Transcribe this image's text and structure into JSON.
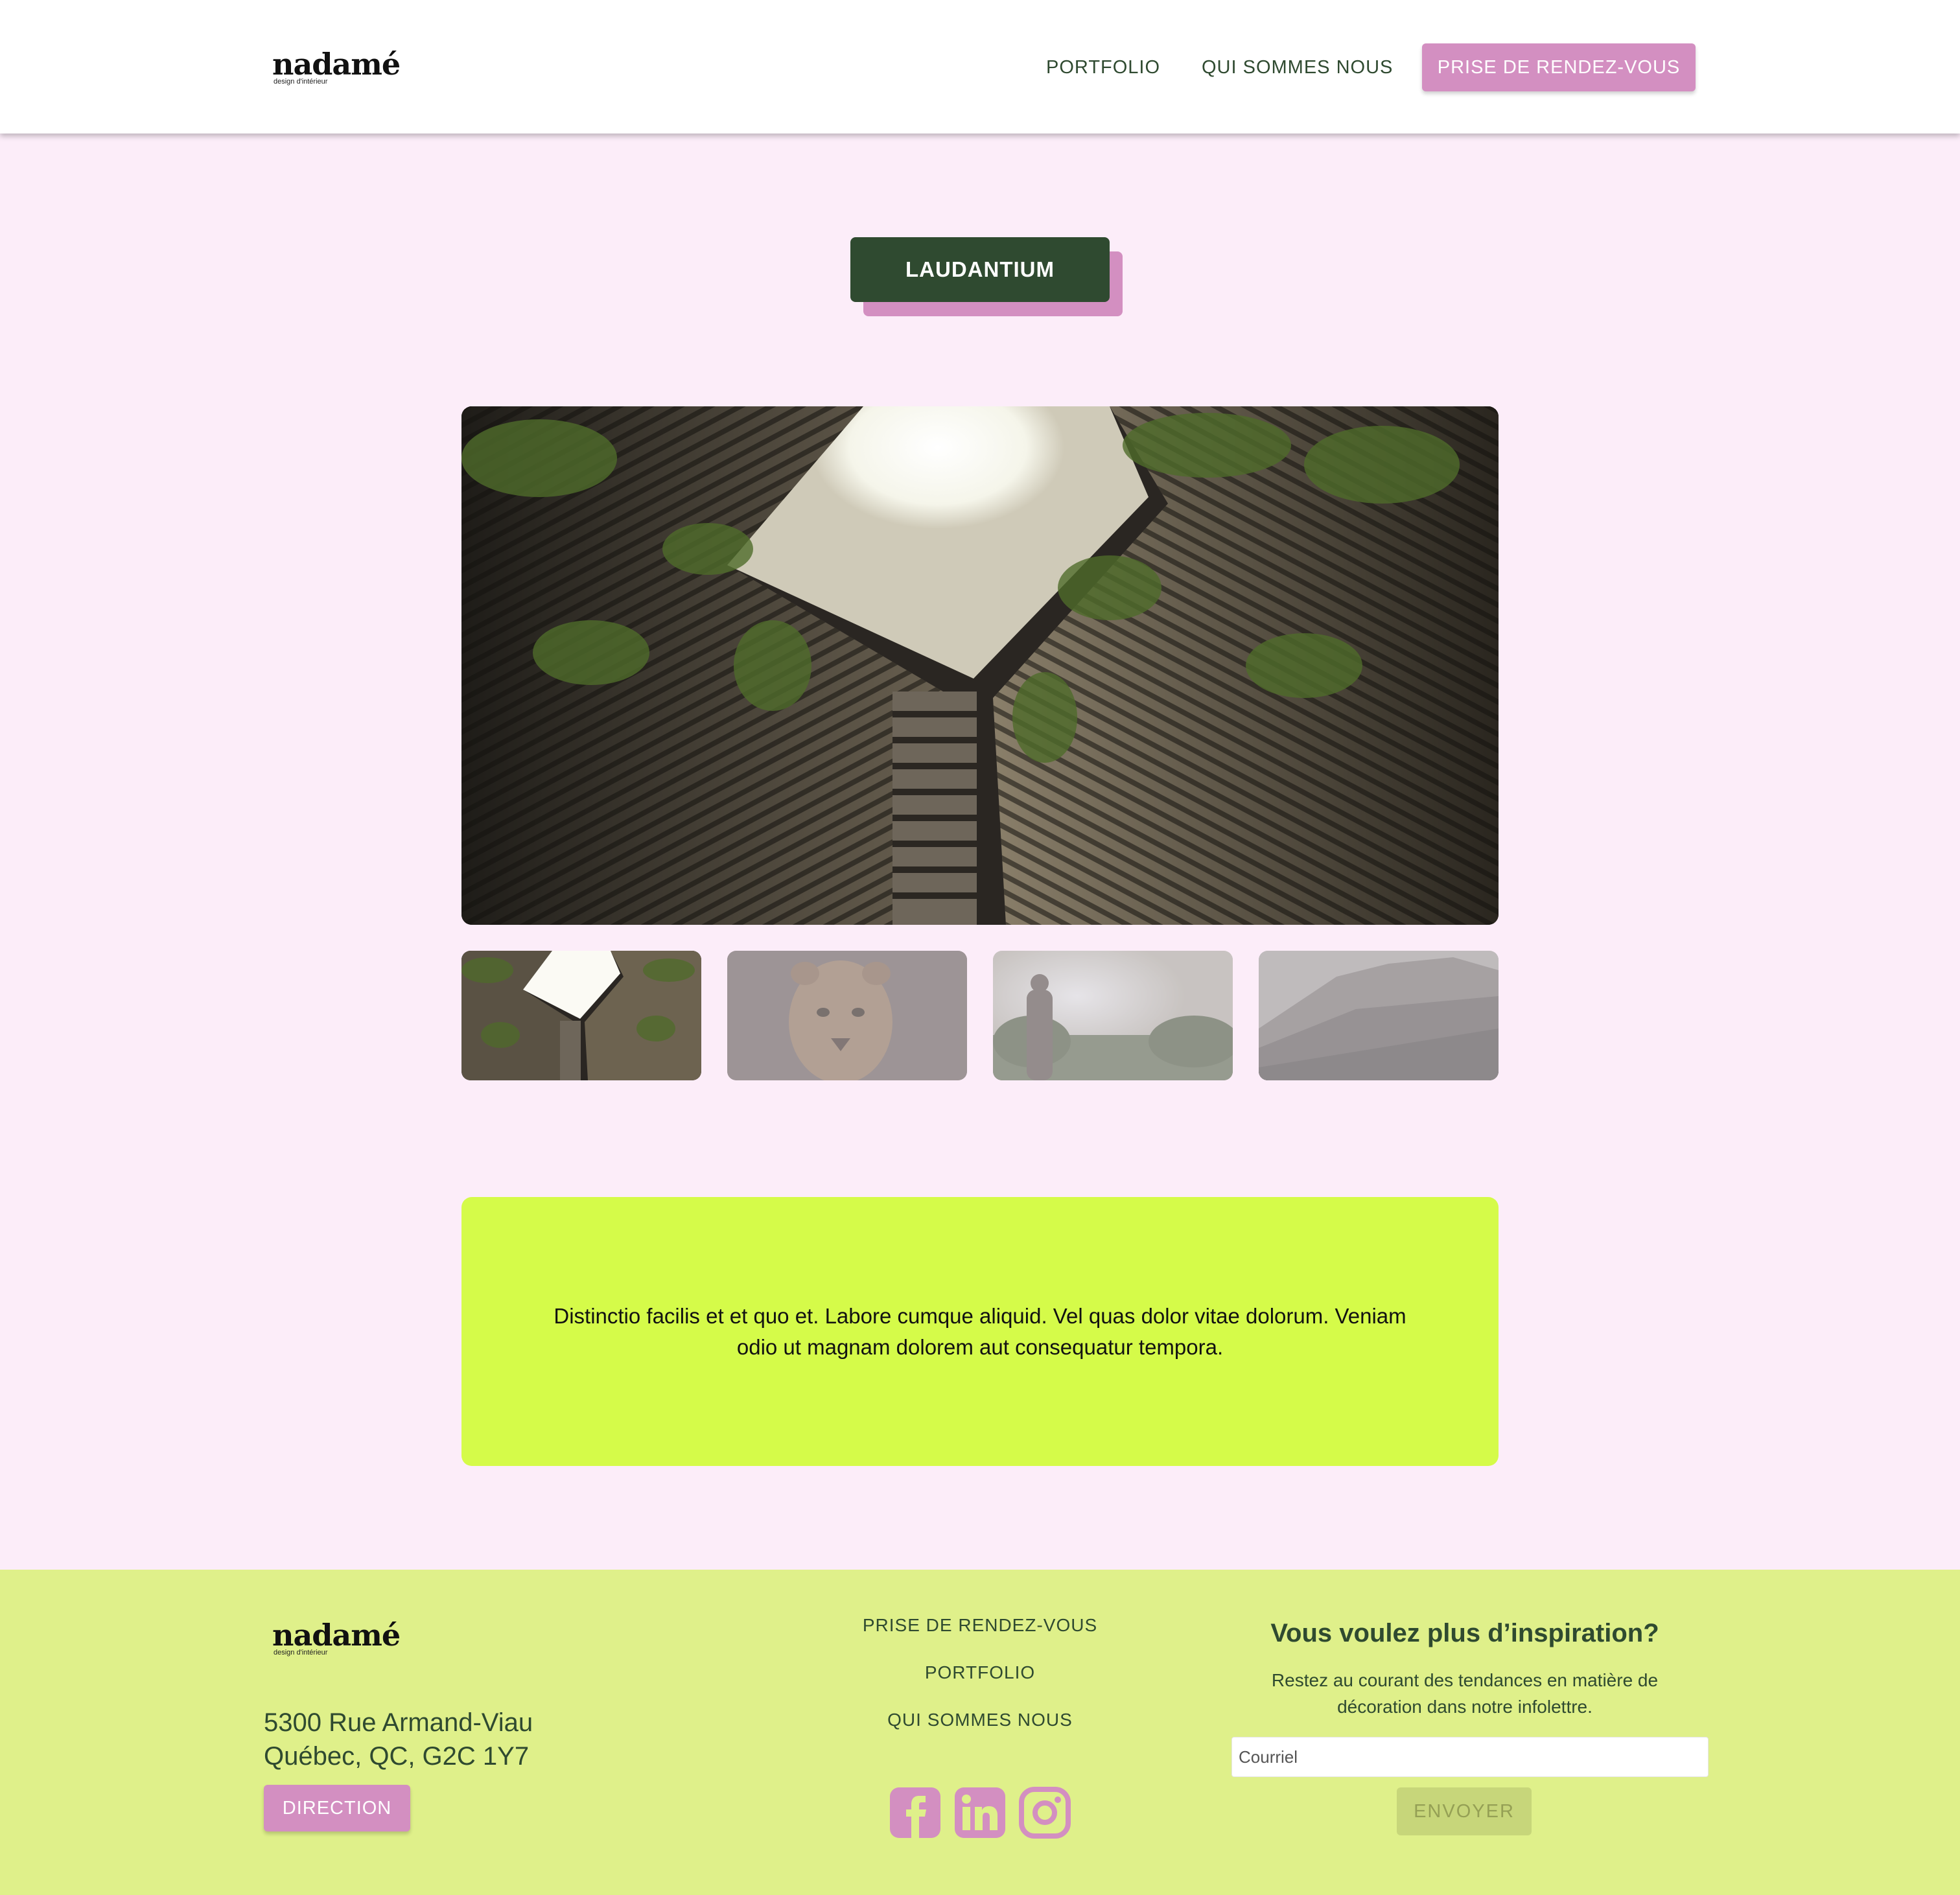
{
  "brand": {
    "name": "nadamé",
    "tagline": "design d'intérieur"
  },
  "nav": {
    "portfolio": "PORTFOLIO",
    "about": "QUI SOMMES NOUS",
    "appointment": "PRISE DE RENDEZ-VOUS"
  },
  "project": {
    "title": "LAUDANTIUM",
    "gallery": {
      "main": "building-courtyard-photo",
      "thumbnails": [
        {
          "subject": "building-courtyard-photo",
          "selected": true
        },
        {
          "subject": "lioness-photo",
          "selected": false
        },
        {
          "subject": "hiker-sunlight-photo",
          "selected": false
        },
        {
          "subject": "mountain-landscape-photo",
          "selected": false
        }
      ]
    },
    "description": "Distinctio facilis et et quo et. Labore cumque aliquid. Vel quas dolor vitae dolorum. Veniam odio ut magnam dolorem aut consequatur tempora."
  },
  "footer": {
    "address_line1": "5300 Rue Armand-Viau",
    "address_line2": "Québec, QC, G2C 1Y7",
    "direction_label": "DIRECTION",
    "links": {
      "appointment": "PRISE DE RENDEZ-VOUS",
      "portfolio": "PORTFOLIO",
      "about": "QUI SOMMES NOUS"
    },
    "social": [
      "facebook-icon",
      "linkedin-icon",
      "instagram-icon"
    ],
    "newsletter": {
      "title": "Vous voulez plus d’inspiration?",
      "text": "Restez au courant des tendances en matière de décoration dans notre infolettre.",
      "email_placeholder": "Courriel",
      "send_label": "ENVOYER"
    }
  },
  "colors": {
    "background": "#fcedf9",
    "primary_green": "#2f4a30",
    "accent_pink": "#d38fc1",
    "lime": "#d5fb49",
    "footer_bg": "#dff08a"
  }
}
